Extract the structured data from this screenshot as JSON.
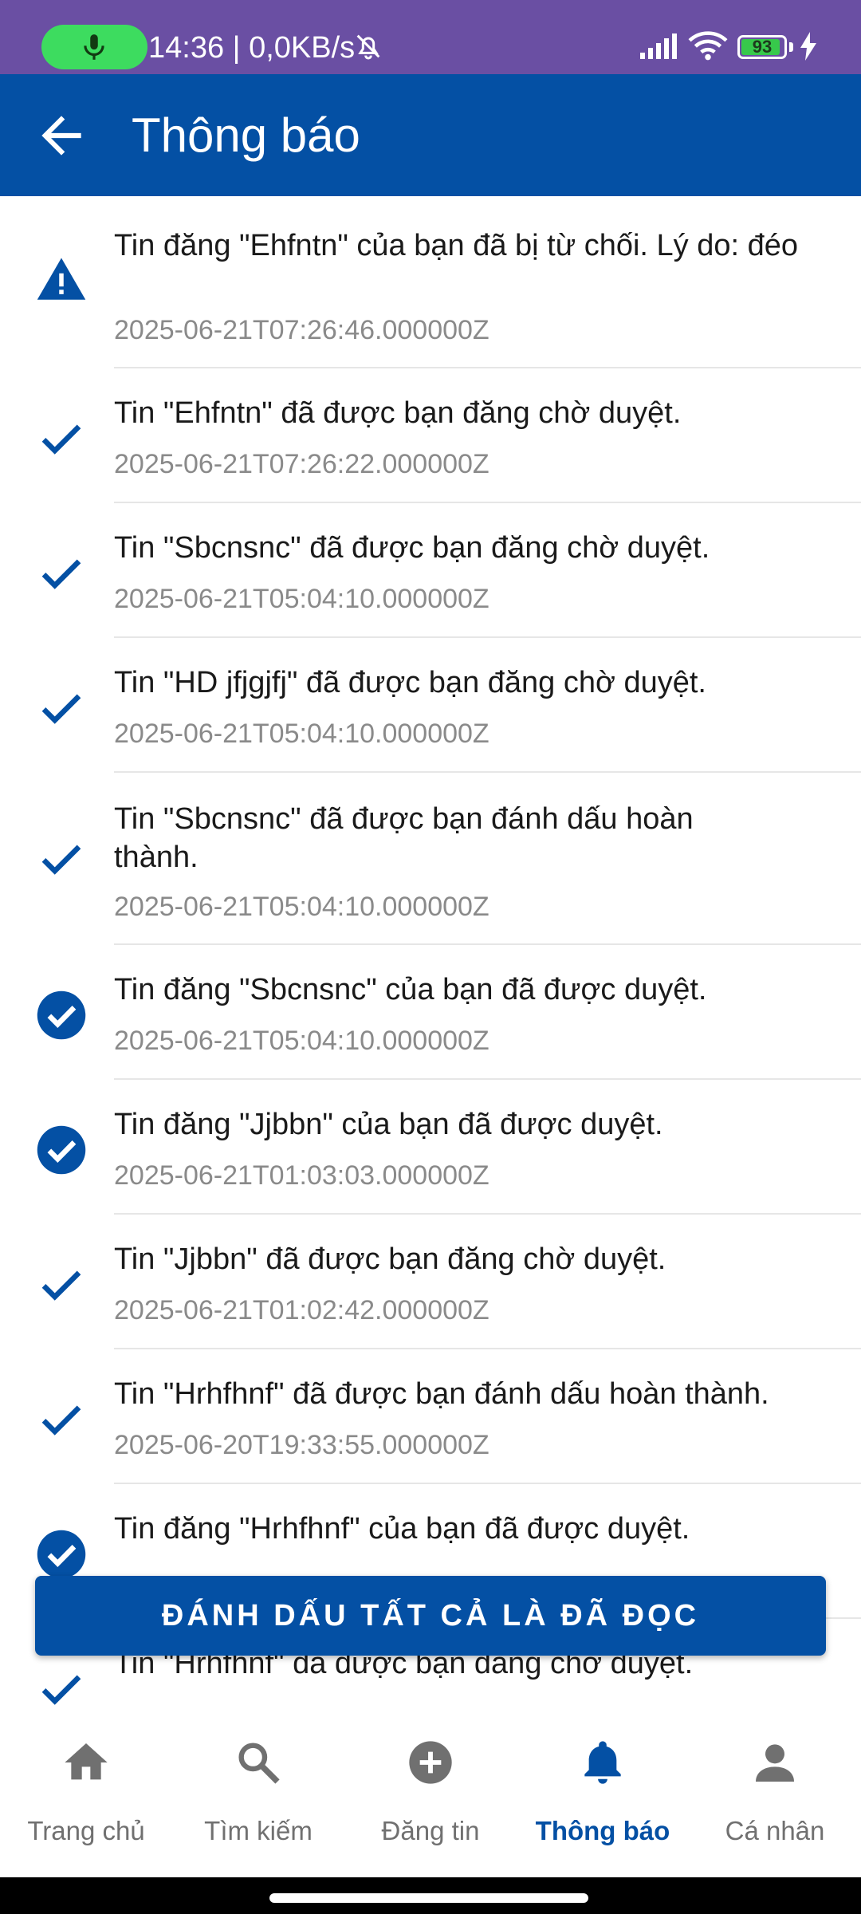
{
  "status_bar": {
    "text": "14:36 | 0,0KB/s",
    "battery": "93",
    "battery_level": 0.93,
    "icons": [
      "mic-icon",
      "bell-off-icon",
      "signal-icon",
      "wifi-icon",
      "battery-icon",
      "charging-icon"
    ]
  },
  "app_bar": {
    "title": "Thông báo",
    "back_icon": "arrow-back-icon"
  },
  "notifications": [
    {
      "icon": "warning-icon",
      "message": "Tin đăng \"Ehfntn\" của bạn đã bị từ chối. Lý do: đéo",
      "time": "2025-06-21T07:26:46.000000Z"
    },
    {
      "icon": "check-icon",
      "message": "Tin \"Ehfntn\" đã được bạn đăng chờ duyệt.",
      "time": "2025-06-21T07:26:22.000000Z"
    },
    {
      "icon": "check-icon",
      "message": "Tin \"Sbcnsnc\" đã được bạn đăng chờ duyệt.",
      "time": "2025-06-21T05:04:10.000000Z"
    },
    {
      "icon": "check-icon",
      "message": "Tin \"HD jfjgjfj\" đã được bạn đăng chờ duyệt.",
      "time": "2025-06-21T05:04:10.000000Z"
    },
    {
      "icon": "check-icon",
      "message": "Tin \"Sbcnsnc\" đã được bạn đánh dấu hoàn thành.",
      "time": "2025-06-21T05:04:10.000000Z"
    },
    {
      "icon": "check-circle-icon",
      "message": "Tin đăng \"Sbcnsnc\" của bạn đã được duyệt.",
      "time": "2025-06-21T05:04:10.000000Z"
    },
    {
      "icon": "check-circle-icon",
      "message": "Tin đăng \"Jjbbn\" của bạn đã được duyệt.",
      "time": "2025-06-21T01:03:03.000000Z"
    },
    {
      "icon": "check-icon",
      "message": "Tin \"Jjbbn\" đã được bạn đăng chờ duyệt.",
      "time": "2025-06-21T01:02:42.000000Z"
    },
    {
      "icon": "check-icon",
      "message": "Tin \"Hrhfhnf\" đã được bạn đánh dấu hoàn thành.",
      "time": "2025-06-20T19:33:55.000000Z"
    },
    {
      "icon": "check-circle-icon",
      "message": "Tin đăng \"Hrhfhnf\" của bạn đã được duyệt.",
      "time": ""
    },
    {
      "icon": "check-icon",
      "message": "Tin \"Hrhfhnf\" đã được bạn đăng chờ duyệt.",
      "time": ""
    }
  ],
  "mark_all_button": "ĐÁNH DẤU TẤT CẢ LÀ ĐÃ ĐỌC",
  "bottom_nav": [
    {
      "label": "Trang chủ",
      "icon": "home-icon",
      "active": false
    },
    {
      "label": "Tìm kiếm",
      "icon": "search-icon",
      "active": false
    },
    {
      "label": "Đăng tin",
      "icon": "add-circle-icon",
      "active": false
    },
    {
      "label": "Thông báo",
      "icon": "bell-icon",
      "active": true
    },
    {
      "label": "Cá nhân",
      "icon": "person-icon",
      "active": false
    }
  ],
  "colors": {
    "primary": "#0450a4",
    "status_bar": "#6a4fa3",
    "active_nav": "#0450a4",
    "inactive_nav": "#707070"
  }
}
